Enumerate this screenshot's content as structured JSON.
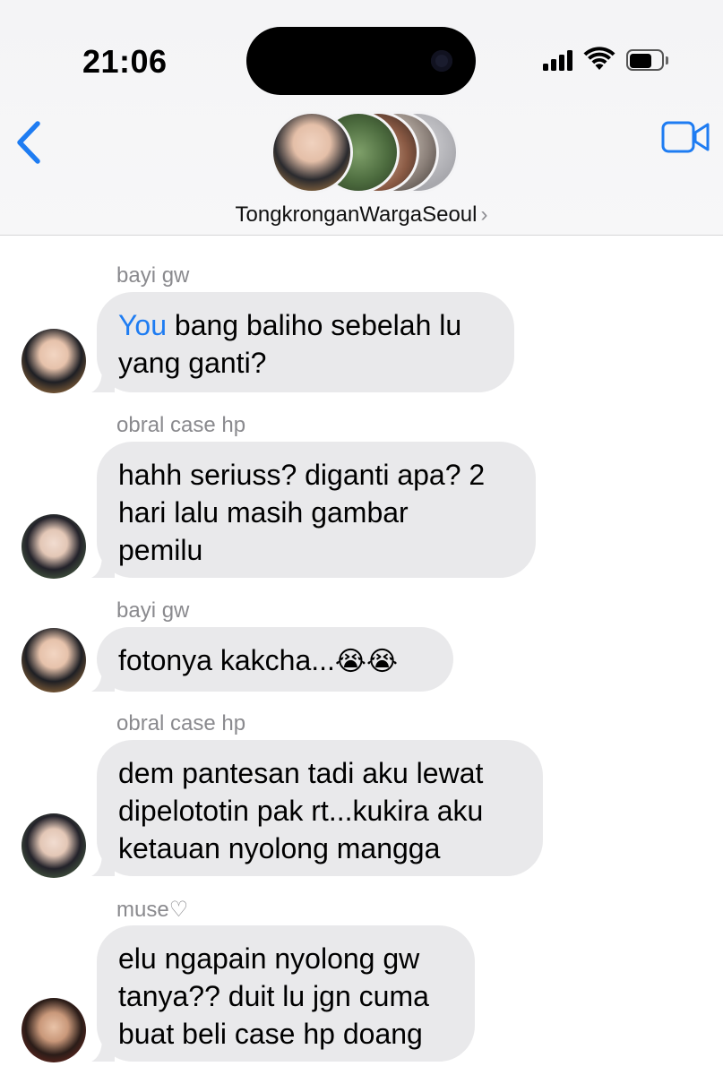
{
  "status_bar": {
    "time": "21:06",
    "signal_bars": 4,
    "battery_level": 0.8
  },
  "header": {
    "back_icon": "chevron-left-icon",
    "video_icon": "video-camera-icon",
    "group_name": "TongkronganWargaSeoul",
    "chevron": "›",
    "accent_color": "#1e7cf2"
  },
  "messages": [
    {
      "sender": "bayi gw",
      "mention": "You",
      "lines": [
        " bang baliho sebelah lu",
        "yang ganti?"
      ]
    },
    {
      "sender": "obral case hp",
      "lines": [
        "hahh seriuss? diganti apa? 2",
        "hari lalu masih gambar",
        "pemilu"
      ]
    },
    {
      "sender": "bayi gw",
      "lines": [
        "fotonya kakcha...",
        "😭😭"
      ]
    },
    {
      "sender": "obral case hp",
      "lines": [
        "dem pantesan tadi aku lewat",
        "dipelototin pak rt...kukira aku",
        "ketauan nyolong mangga"
      ]
    },
    {
      "sender": "muse♡",
      "lines": [
        "elu ngapain nyolong gw",
        "tanya?? duit lu jgn cuma",
        "buat beli case hp doang"
      ]
    }
  ]
}
